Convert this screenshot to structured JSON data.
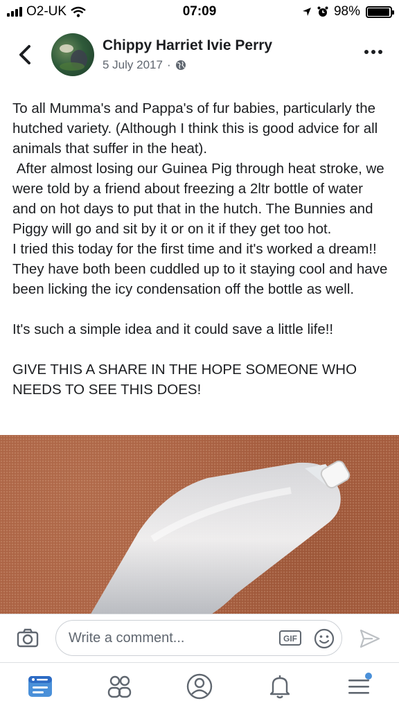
{
  "status_bar": {
    "carrier": "O2-UK",
    "time": "07:09",
    "battery_percent": "98%",
    "battery_level": 0.98
  },
  "post": {
    "author": "Chippy Harriet Ivie Perry",
    "date": "5 July 2017",
    "privacy_separator": "·",
    "privacy_icon": "globe-icon",
    "paragraphs": [
      "To all Mumma's and Pappa's of fur babies, particularly the hutched variety. (Although I think this is good advice for all animals that suffer in the heat).\n After almost losing our Guinea Pig through heat stroke, we were told by a friend about freezing a 2ltr bottle of water and on hot days to put that in the hutch. The Bunnies and Piggy will go and sit by it or on it if they get too hot.\nI tried this today for the first time and it's worked a dream!! They have both been cuddled up to it staying cool and have been licking the icy condensation off the bottle as well.",
      "It's such a simple idea and it could save a little life!!",
      "GIVE THIS A SHARE IN THE HOPE SOMEONE WHO NEEDS TO SEE THIS DOES!"
    ]
  },
  "comment_bar": {
    "placeholder": "Write a comment...",
    "gif_label": "GIF"
  },
  "bottom_nav": {
    "items": [
      "news-feed-icon",
      "groups-icon",
      "profile-icon",
      "notifications-icon",
      "menu-icon"
    ]
  },
  "colors": {
    "accent": "#4a90d9",
    "text": "#1c1e21",
    "muted": "#606770",
    "border": "#dddfe2",
    "carpet": "#a85e40"
  }
}
